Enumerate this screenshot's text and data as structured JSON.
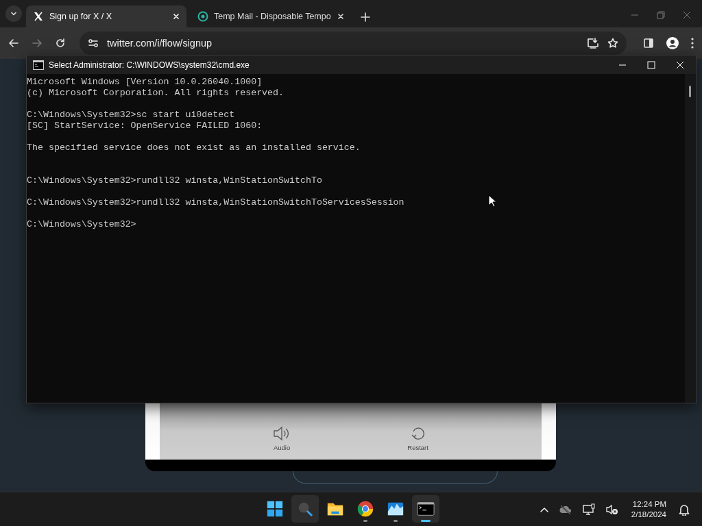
{
  "browser": {
    "tabs": [
      {
        "title": "Sign up for X / X",
        "selected": true
      },
      {
        "title": "Temp Mail - Disposable Tempo",
        "selected": false
      }
    ],
    "address": "twitter.com/i/flow/signup"
  },
  "console": {
    "title": "Select Administrator: C:\\WINDOWS\\system32\\cmd.exe",
    "lines": [
      {
        "kind": "text",
        "text": "Microsoft Windows [Version 10.0.26040.1000]"
      },
      {
        "kind": "text",
        "text": "(c) Microsoft Corporation. All rights reserved."
      },
      {
        "kind": "blank"
      },
      {
        "kind": "text",
        "text": "C:\\Windows\\System32>sc start ui0detect"
      },
      {
        "kind": "text",
        "text": "[SC] StartService: OpenService FAILED 1060:"
      },
      {
        "kind": "blank"
      },
      {
        "kind": "text",
        "text": "The specified service does not exist as an installed service."
      },
      {
        "kind": "blank"
      },
      {
        "kind": "blank"
      },
      {
        "kind": "text",
        "text": "C:\\Windows\\System32>rundll32 winsta,WinStationSwitchTo"
      },
      {
        "kind": "blank"
      },
      {
        "kind": "text",
        "text": "C:\\Windows\\System32>rundll32 winsta,WinStationSwitchToServicesSession"
      },
      {
        "kind": "blank"
      },
      {
        "kind": "text",
        "text": "C:\\Windows\\System32>"
      }
    ]
  },
  "captcha": {
    "buttons": [
      {
        "kind": "audio",
        "label": "Audio"
      },
      {
        "kind": "restart",
        "label": "Restart"
      }
    ]
  },
  "taskbar": {
    "apps": [
      {
        "kind": "start",
        "highlighted": false,
        "running": false,
        "selected": false
      },
      {
        "kind": "search",
        "highlighted": true,
        "running": false,
        "selected": false
      },
      {
        "kind": "folder",
        "highlighted": false,
        "running": false,
        "selected": false
      },
      {
        "kind": "browser",
        "highlighted": false,
        "running": true,
        "selected": false
      },
      {
        "kind": "photos",
        "highlighted": false,
        "running": true,
        "selected": false
      },
      {
        "kind": "terminal",
        "highlighted": true,
        "running": true,
        "selected": true
      }
    ],
    "clock": {
      "time": "12:24 PM",
      "date": "2/18/2024"
    }
  }
}
